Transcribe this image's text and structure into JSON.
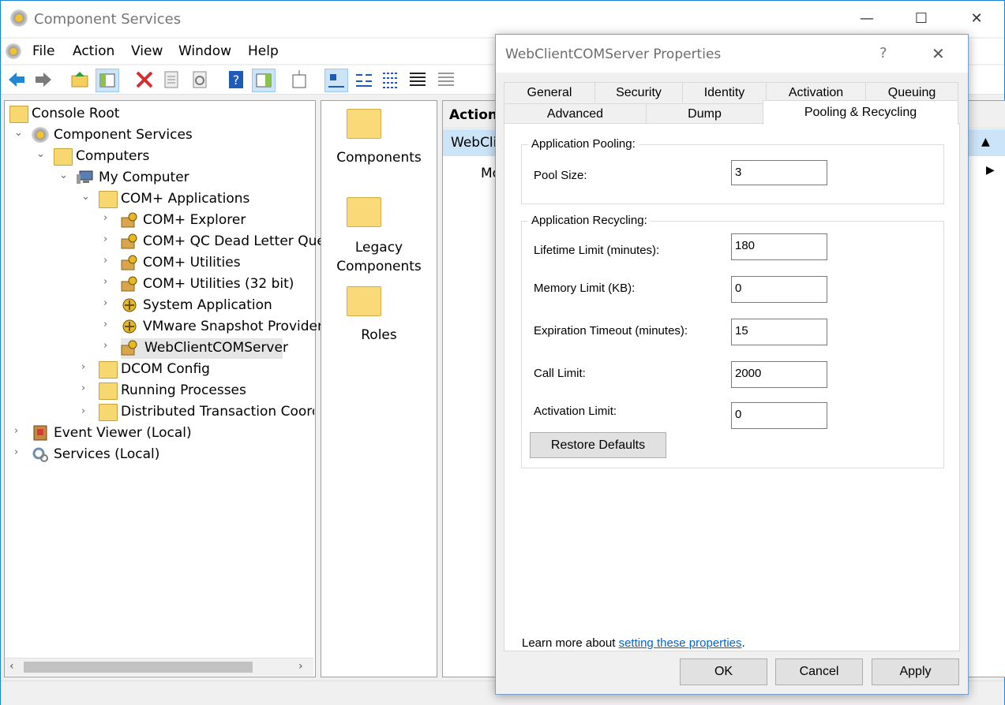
{
  "window": {
    "title": "Component Services",
    "minimize": "—",
    "maximize": "☐",
    "close": "✕"
  },
  "menu": [
    "File",
    "Action",
    "View",
    "Window",
    "Help"
  ],
  "tree": {
    "root": "Console Root",
    "component_services": "Component Services",
    "computers": "Computers",
    "my_computer": "My Computer",
    "com_apps": "COM+ Applications",
    "apps": [
      "COM+ Explorer",
      "COM+ QC Dead Letter Que",
      "COM+ Utilities",
      "COM+ Utilities (32 bit)",
      "System Application",
      "VMware Snapshot Provider",
      "WebClientCOMServer"
    ],
    "dcom_config": "DCOM Config",
    "running_processes": "Running Processes",
    "dtc": "Distributed Transaction Coordir",
    "event_viewer": "Event Viewer (Local)",
    "services": "Services (Local)"
  },
  "middle": {
    "items": [
      "Components",
      "Legacy Components",
      "Roles"
    ]
  },
  "actions": {
    "header": "Actions",
    "selected": "WebCli",
    "more": "Mo"
  },
  "dialog": {
    "title": "WebClientCOMServer Properties",
    "help": "?",
    "close": "✕",
    "tabs_row1": [
      "General",
      "Security",
      "Identity",
      "Activation",
      "Queuing"
    ],
    "tabs_row2": [
      "Advanced",
      "Dump",
      "Pooling & Recycling"
    ],
    "pooling": {
      "legend": "Application Pooling:",
      "pool_size_label": "Pool Size:",
      "pool_size": "3"
    },
    "recycling": {
      "legend": "Application Recycling:",
      "lifetime_label": "Lifetime Limit (minutes):",
      "lifetime": "180",
      "memory_label": "Memory Limit (KB):",
      "memory": "0",
      "expiration_label": "Expiration Timeout (minutes):",
      "expiration": "15",
      "call_label": "Call Limit:",
      "call": "2000",
      "activation_label": "Activation Limit:",
      "activation": "0",
      "restore": "Restore Defaults"
    },
    "learn_prefix": "Learn more about ",
    "learn_link": "setting these properties",
    "learn_suffix": ".",
    "ok": "OK",
    "cancel": "Cancel",
    "apply": "Apply"
  }
}
